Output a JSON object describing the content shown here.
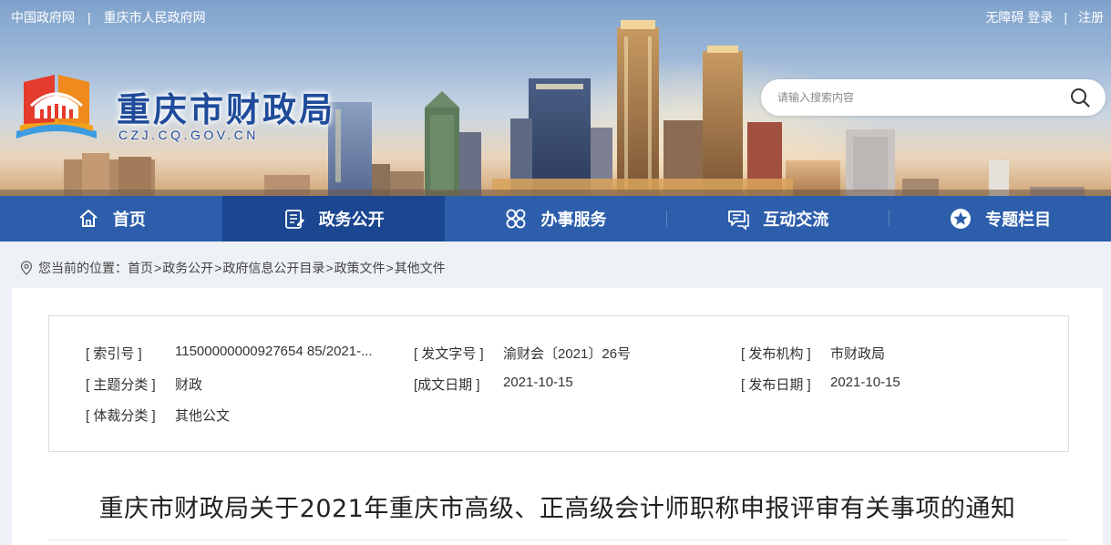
{
  "top_links": {
    "left": [
      "中国政府网",
      "重庆市人民政府网"
    ],
    "separator": "|",
    "right": [
      "无障碍",
      "登录",
      "注册"
    ]
  },
  "site": {
    "title": "重庆市财政局",
    "domain": "CZJ.CQ.GOV.CN"
  },
  "search": {
    "placeholder": "请输入搜索内容",
    "icon": "search-icon"
  },
  "nav": [
    {
      "label": "首页",
      "icon": "home-icon",
      "active": false
    },
    {
      "label": "政务公开",
      "icon": "document-list-icon",
      "active": true
    },
    {
      "label": "办事服务",
      "icon": "grid-flower-icon",
      "active": false
    },
    {
      "label": "互动交流",
      "icon": "chat-icon",
      "active": false
    },
    {
      "label": "专题栏目",
      "icon": "star-circle-icon",
      "active": false
    }
  ],
  "breadcrumb": {
    "prefix": "您当前的位置：",
    "items": [
      "首页",
      "政务公开",
      "政府信息公开目录",
      "政策文件",
      "其他文件"
    ],
    "separator": ">"
  },
  "meta": {
    "index_no": {
      "label": "[ 索引号 ]",
      "value": "11500000000927654 85/2021-..."
    },
    "doc_no": {
      "label": "[ 发文字号 ]",
      "value": "渝财会〔2021〕26号"
    },
    "publisher": {
      "label": "[ 发布机构 ]",
      "value": "市财政局"
    },
    "topic": {
      "label": "[ 主题分类 ]",
      "value": "财政"
    },
    "written_date": {
      "label": "[成文日期 ]",
      "value": "2021-10-15"
    },
    "publish_date": {
      "label": "[ 发布日期 ]",
      "value": "2021-10-15"
    },
    "genre": {
      "label": "[ 体裁分类 ]",
      "value": "其他公文"
    }
  },
  "document": {
    "title": "重庆市财政局关于2021年重庆市高级、正高级会计师职称申报评审有关事项的通知"
  },
  "colors": {
    "nav_bg": "#2d5eab",
    "nav_active": "#1b4690",
    "title_blue": "#1f4b9a"
  }
}
